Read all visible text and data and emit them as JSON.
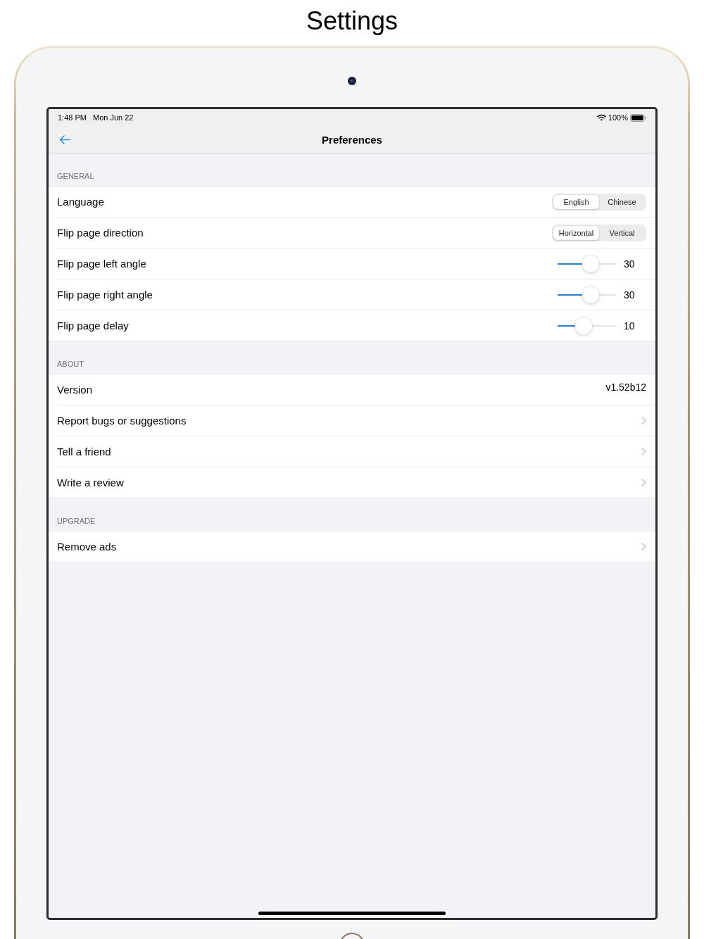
{
  "title": "Settings",
  "status_bar": {
    "time": "1:48 PM",
    "date": "Mon Jun 22",
    "battery": "100%"
  },
  "nav_bar": {
    "title": "Preferences"
  },
  "sections": [
    {
      "header": "GENERAL",
      "rows": [
        {
          "kind": "segmented",
          "label": "Language",
          "options": [
            {
              "label": "English",
              "selected": true
            },
            {
              "label": "Chinese",
              "selected": false
            }
          ]
        },
        {
          "kind": "segmented",
          "label": "Flip page direction",
          "options": [
            {
              "label": "Horizontal",
              "selected": true
            },
            {
              "label": "Vertical",
              "selected": false
            }
          ]
        },
        {
          "kind": "slider",
          "label": "Flip page left angle",
          "level": 0.58,
          "reading": "30"
        },
        {
          "kind": "slider",
          "label": "Flip page right angle",
          "level": 0.58,
          "reading": "30"
        },
        {
          "kind": "slider",
          "label": "Flip page delay",
          "level": 0.42,
          "reading": "10"
        }
      ]
    },
    {
      "header": "ABOUT",
      "rows": [
        {
          "kind": "value",
          "label": "Version",
          "value": "v1.52b12"
        },
        {
          "kind": "link",
          "label": "Report bugs or suggestions"
        },
        {
          "kind": "link",
          "label": "Tell a friend"
        },
        {
          "kind": "link",
          "label": "Write a review"
        }
      ]
    },
    {
      "header": "UPGRADE",
      "rows": [
        {
          "kind": "link",
          "label": "Remove ads"
        }
      ]
    }
  ]
}
